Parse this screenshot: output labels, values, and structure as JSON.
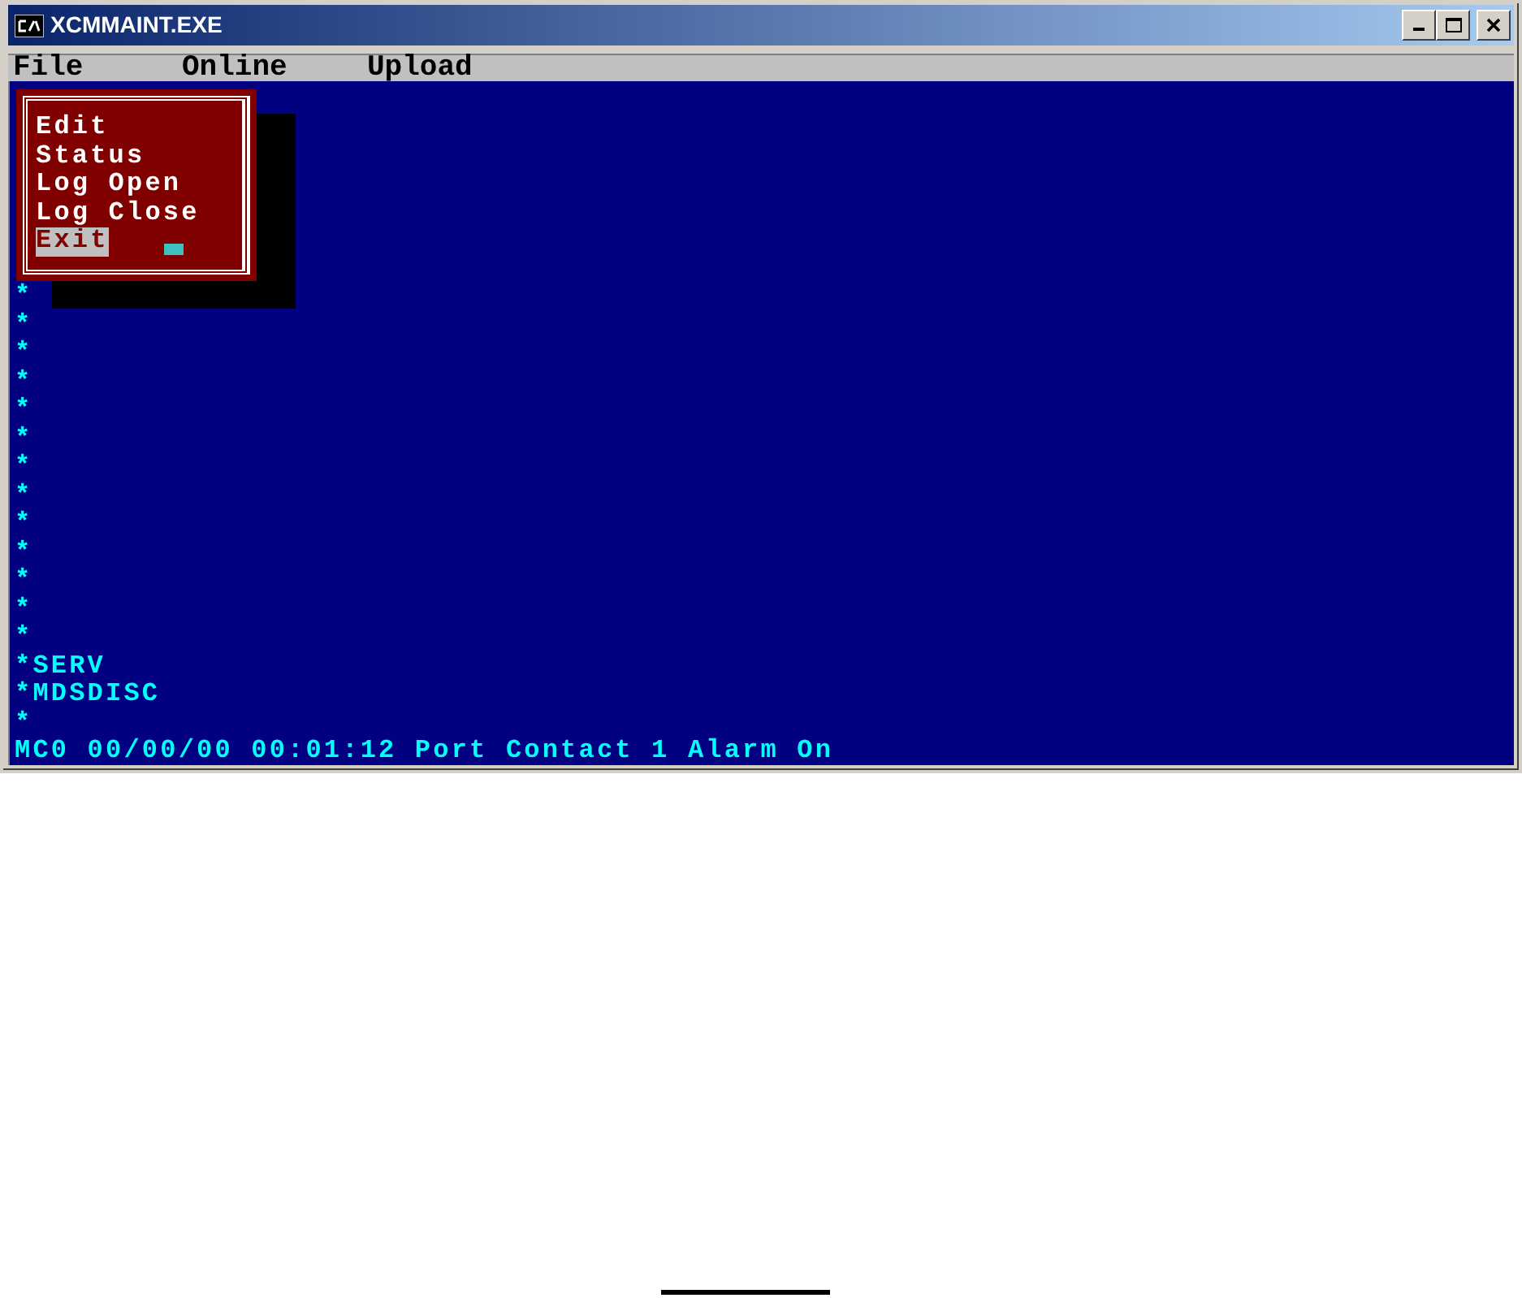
{
  "window": {
    "title": "XCMMAINT.EXE"
  },
  "menu_bar": [
    {
      "label": "File"
    },
    {
      "label": "Online"
    },
    {
      "label": "Upload"
    }
  ],
  "dropdown": [
    {
      "label": "Edit",
      "selected": false
    },
    {
      "label": "Status",
      "selected": false
    },
    {
      "label": "Log Open",
      "selected": false
    },
    {
      "label": "Log Close",
      "selected": false
    },
    {
      "label": "Exit",
      "selected": true
    }
  ],
  "console_lines": [
    "*",
    "*",
    "*",
    "*",
    "*",
    "*",
    "*",
    "*",
    "*",
    "*",
    "*",
    "*",
    "*",
    "*SERV",
    "*MDSDISC",
    "*",
    "MC0 00/00/00 00:01:12 Port Contact 1 Alarm On"
  ]
}
